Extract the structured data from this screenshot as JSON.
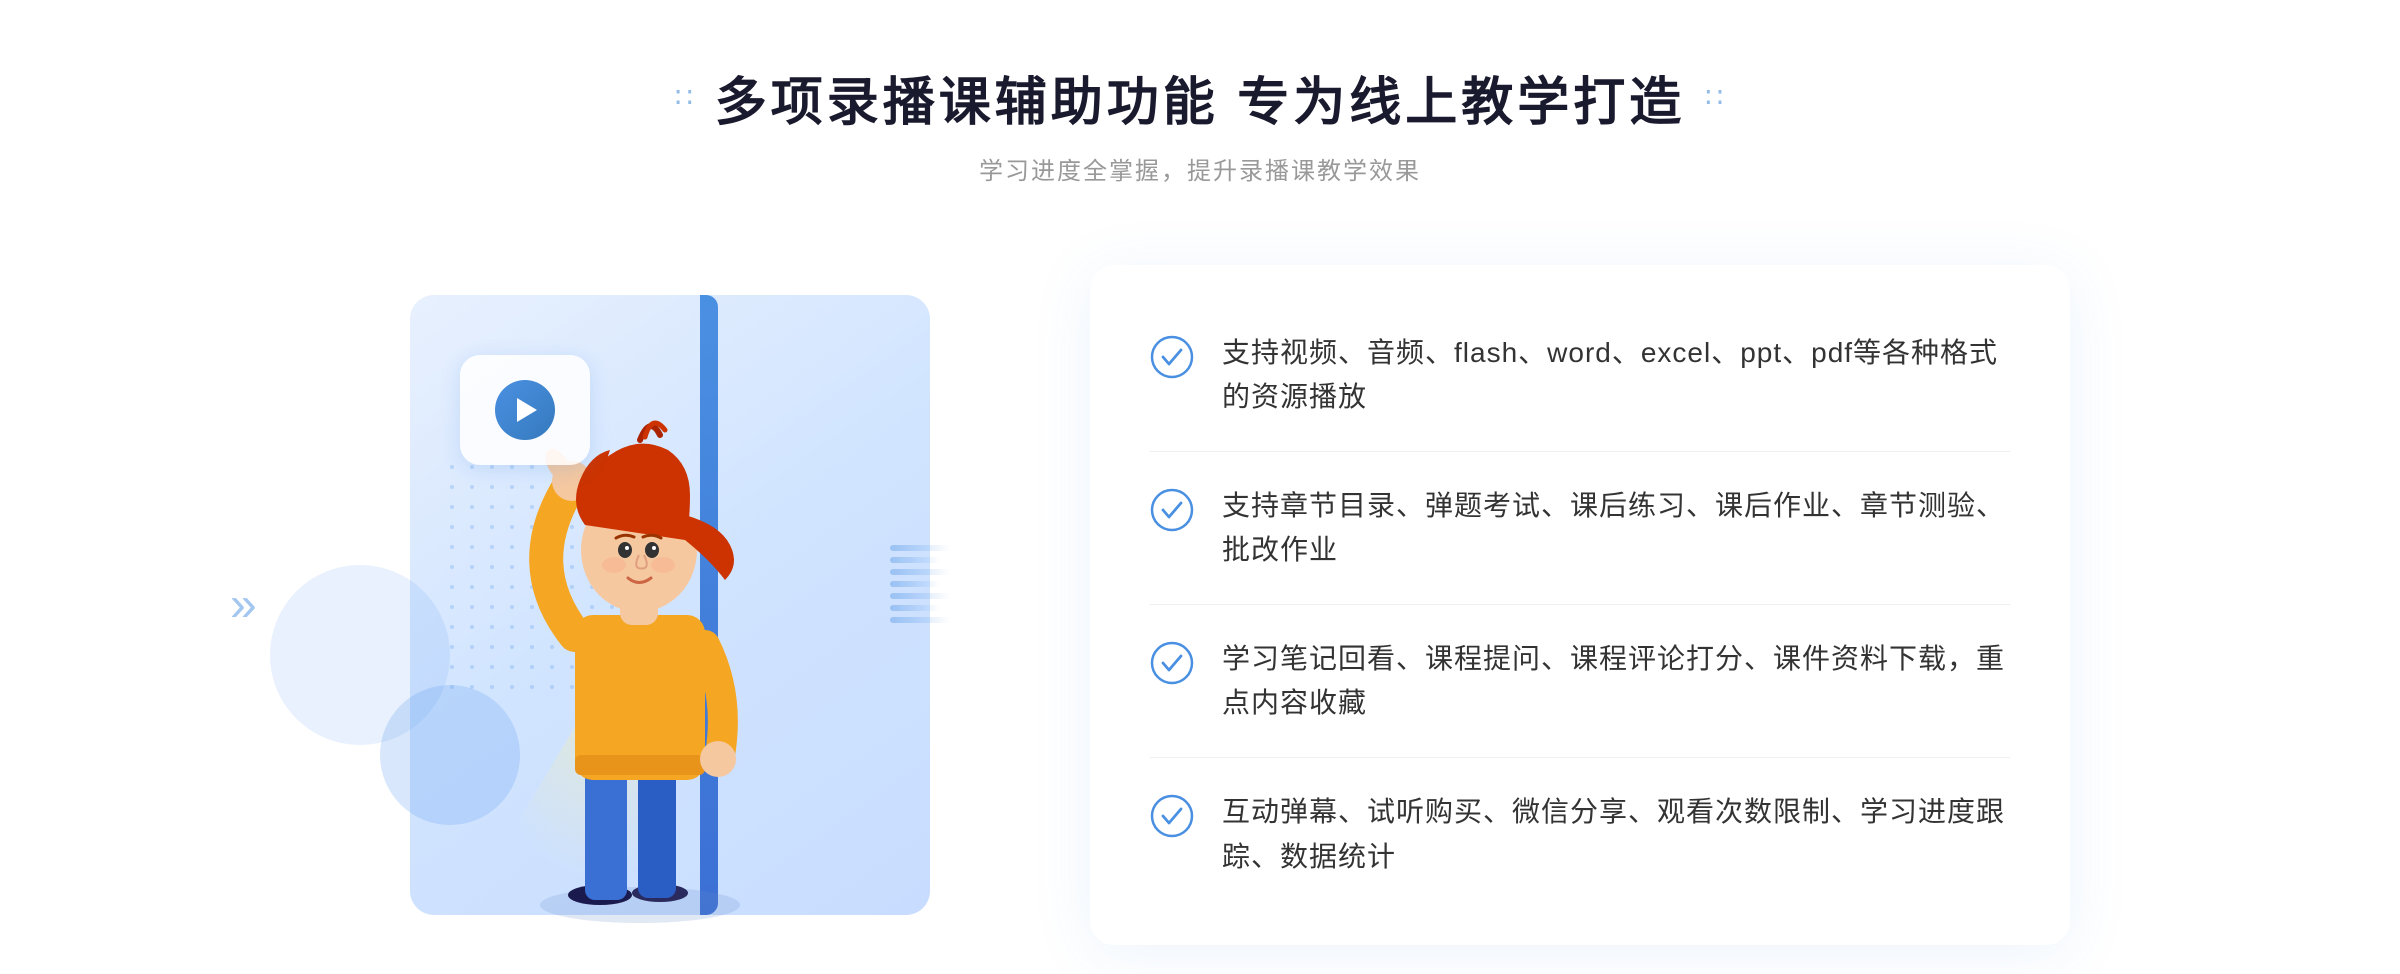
{
  "header": {
    "title": "多项录播课辅助功能 专为线上教学打造",
    "subtitle": "学习进度全掌握，提升录播课教学效果",
    "left_dots": "∷",
    "right_dots": "∷"
  },
  "features": [
    {
      "id": 1,
      "text": "支持视频、音频、flash、word、excel、ppt、pdf等各种格式的资源播放"
    },
    {
      "id": 2,
      "text": "支持章节目录、弹题考试、课后练习、课后作业、章节测验、批改作业"
    },
    {
      "id": 3,
      "text": "学习笔记回看、课程提问、课程评论打分、课件资料下载，重点内容收藏"
    },
    {
      "id": 4,
      "text": "互动弹幕、试听购买、微信分享、观看次数限制、学习进度跟踪、数据统计"
    }
  ]
}
